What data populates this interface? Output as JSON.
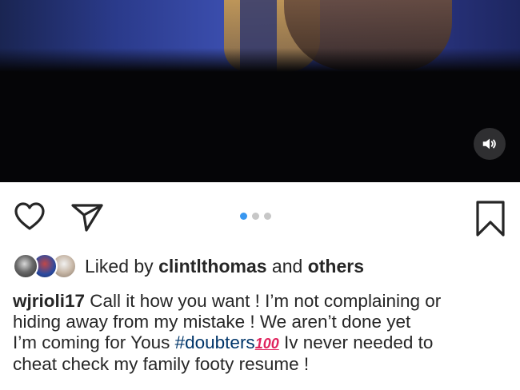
{
  "post": {
    "media": {
      "type": "video",
      "sound_button_icon": "speaker-icon"
    },
    "actions": {
      "like_icon": "heart-icon",
      "share_icon": "paper-plane-icon",
      "save_icon": "bookmark-icon"
    },
    "carousel": {
      "total": 3,
      "active_index": 0,
      "active_color": "#3897f0",
      "inactive_color": "#c7c7c7"
    },
    "likes": {
      "prefix": "Liked by ",
      "user": "clintlthomas",
      "middle": " and ",
      "suffix": "others"
    },
    "caption": {
      "username": "wjrioli17",
      "line1": " Call it how you want ! I’m not complaining or",
      "line2": "hiding away from my mistake ! We aren’t done yet",
      "line3_before": "I’m coming for Yous ",
      "hashtag": "#doubters",
      "emoji": "100",
      "line3_after": "  Iv never needed to",
      "line4": "cheat check my family footy resume !"
    },
    "colors": {
      "text": "#262626",
      "hashtag": "#003569",
      "video_bg": "#050507"
    }
  }
}
